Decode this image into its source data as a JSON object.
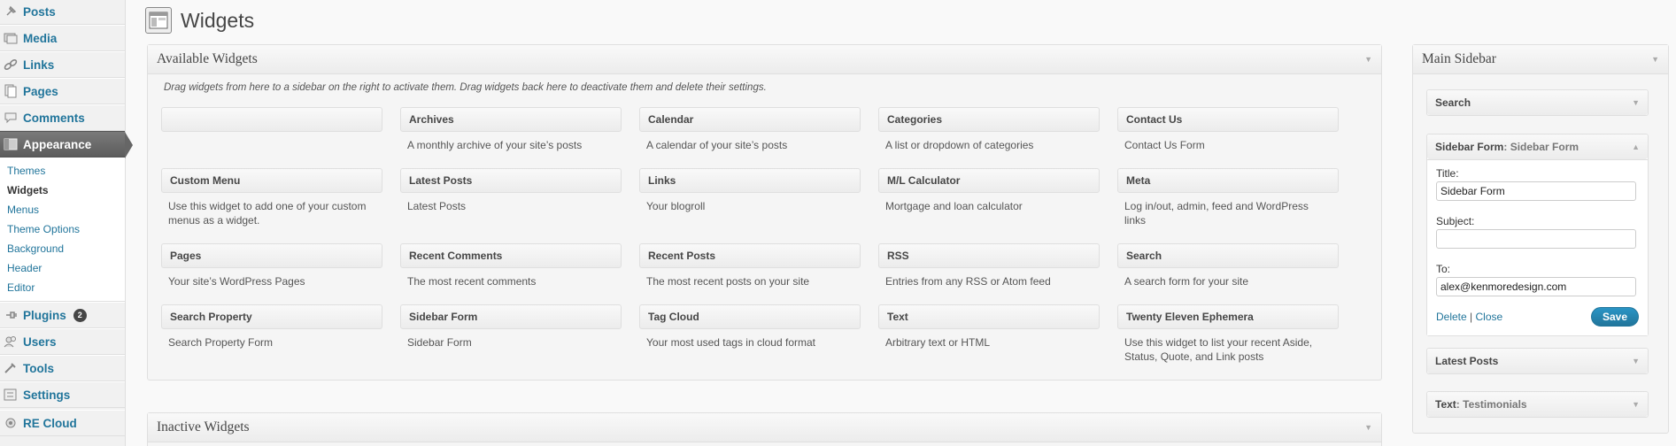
{
  "sidebar": {
    "items": [
      {
        "label": "Posts",
        "icon": "pin-icon"
      },
      {
        "label": "Media",
        "icon": "media-icon"
      },
      {
        "label": "Links",
        "icon": "link-icon"
      },
      {
        "label": "Pages",
        "icon": "page-icon"
      },
      {
        "label": "Comments",
        "icon": "comment-icon"
      },
      {
        "label": "Appearance",
        "icon": "appearance-icon"
      },
      {
        "label": "Plugins",
        "icon": "plugin-icon",
        "badge": "2"
      },
      {
        "label": "Users",
        "icon": "users-icon"
      },
      {
        "label": "Tools",
        "icon": "tools-icon"
      },
      {
        "label": "Settings",
        "icon": "settings-icon"
      },
      {
        "label": "RE Cloud",
        "icon": "cloud-icon"
      }
    ],
    "appearance_submenu": [
      "Themes",
      "Widgets",
      "Menus",
      "Theme Options",
      "Background",
      "Header",
      "Editor"
    ]
  },
  "header": {
    "title": "Widgets"
  },
  "available": {
    "title": "Available Widgets",
    "intro": "Drag widgets from here to a sidebar on the right to activate them. Drag widgets back here to deactivate them and delete their settings.",
    "widgets": [
      {
        "title": "",
        "desc": ""
      },
      {
        "title": "Archives",
        "desc": "A monthly archive of your site’s posts"
      },
      {
        "title": "Calendar",
        "desc": "A calendar of your site’s posts"
      },
      {
        "title": "Categories",
        "desc": "A list or dropdown of categories"
      },
      {
        "title": "Contact Us",
        "desc": "Contact Us Form"
      },
      {
        "title": "Custom Menu",
        "desc": "Use this widget to add one of your custom menus as a widget."
      },
      {
        "title": "Latest Posts",
        "desc": "Latest Posts"
      },
      {
        "title": "Links",
        "desc": "Your blogroll"
      },
      {
        "title": "M/L Calculator",
        "desc": "Mortgage and loan calculator"
      },
      {
        "title": "Meta",
        "desc": "Log in/out, admin, feed and WordPress links"
      },
      {
        "title": "Pages",
        "desc": "Your site’s WordPress Pages"
      },
      {
        "title": "Recent Comments",
        "desc": "The most recent comments"
      },
      {
        "title": "Recent Posts",
        "desc": "The most recent posts on your site"
      },
      {
        "title": "RSS",
        "desc": "Entries from any RSS or Atom feed"
      },
      {
        "title": "Search",
        "desc": "A search form for your site"
      },
      {
        "title": "Search Property",
        "desc": "Search Property Form"
      },
      {
        "title": "Sidebar Form",
        "desc": "Sidebar Form"
      },
      {
        "title": "Tag Cloud",
        "desc": "Your most used tags in cloud format"
      },
      {
        "title": "Text",
        "desc": "Arbitrary text or HTML"
      },
      {
        "title": "Twenty Eleven Ephemera",
        "desc": "Use this widget to list your recent Aside, Status, Quote, and Link posts"
      }
    ]
  },
  "inactive": {
    "title": "Inactive Widgets"
  },
  "main_sidebar": {
    "title": "Main Sidebar",
    "search_widget": "Search",
    "form_widget": {
      "name": "Sidebar Form",
      "instance_title": "Sidebar Form"
    },
    "form": {
      "title_label": "Title:",
      "title_value": "Sidebar Form",
      "subject_label": "Subject:",
      "subject_value": "",
      "to_label": "To:",
      "to_value": "alex@kenmoredesign.com",
      "delete_label": "Delete",
      "separator": "|",
      "close_label": "Close",
      "save_label": "Save"
    },
    "latest_widget": "Latest Posts",
    "text_widget": {
      "name": "Text",
      "instance_title": "Testimonials"
    }
  }
}
